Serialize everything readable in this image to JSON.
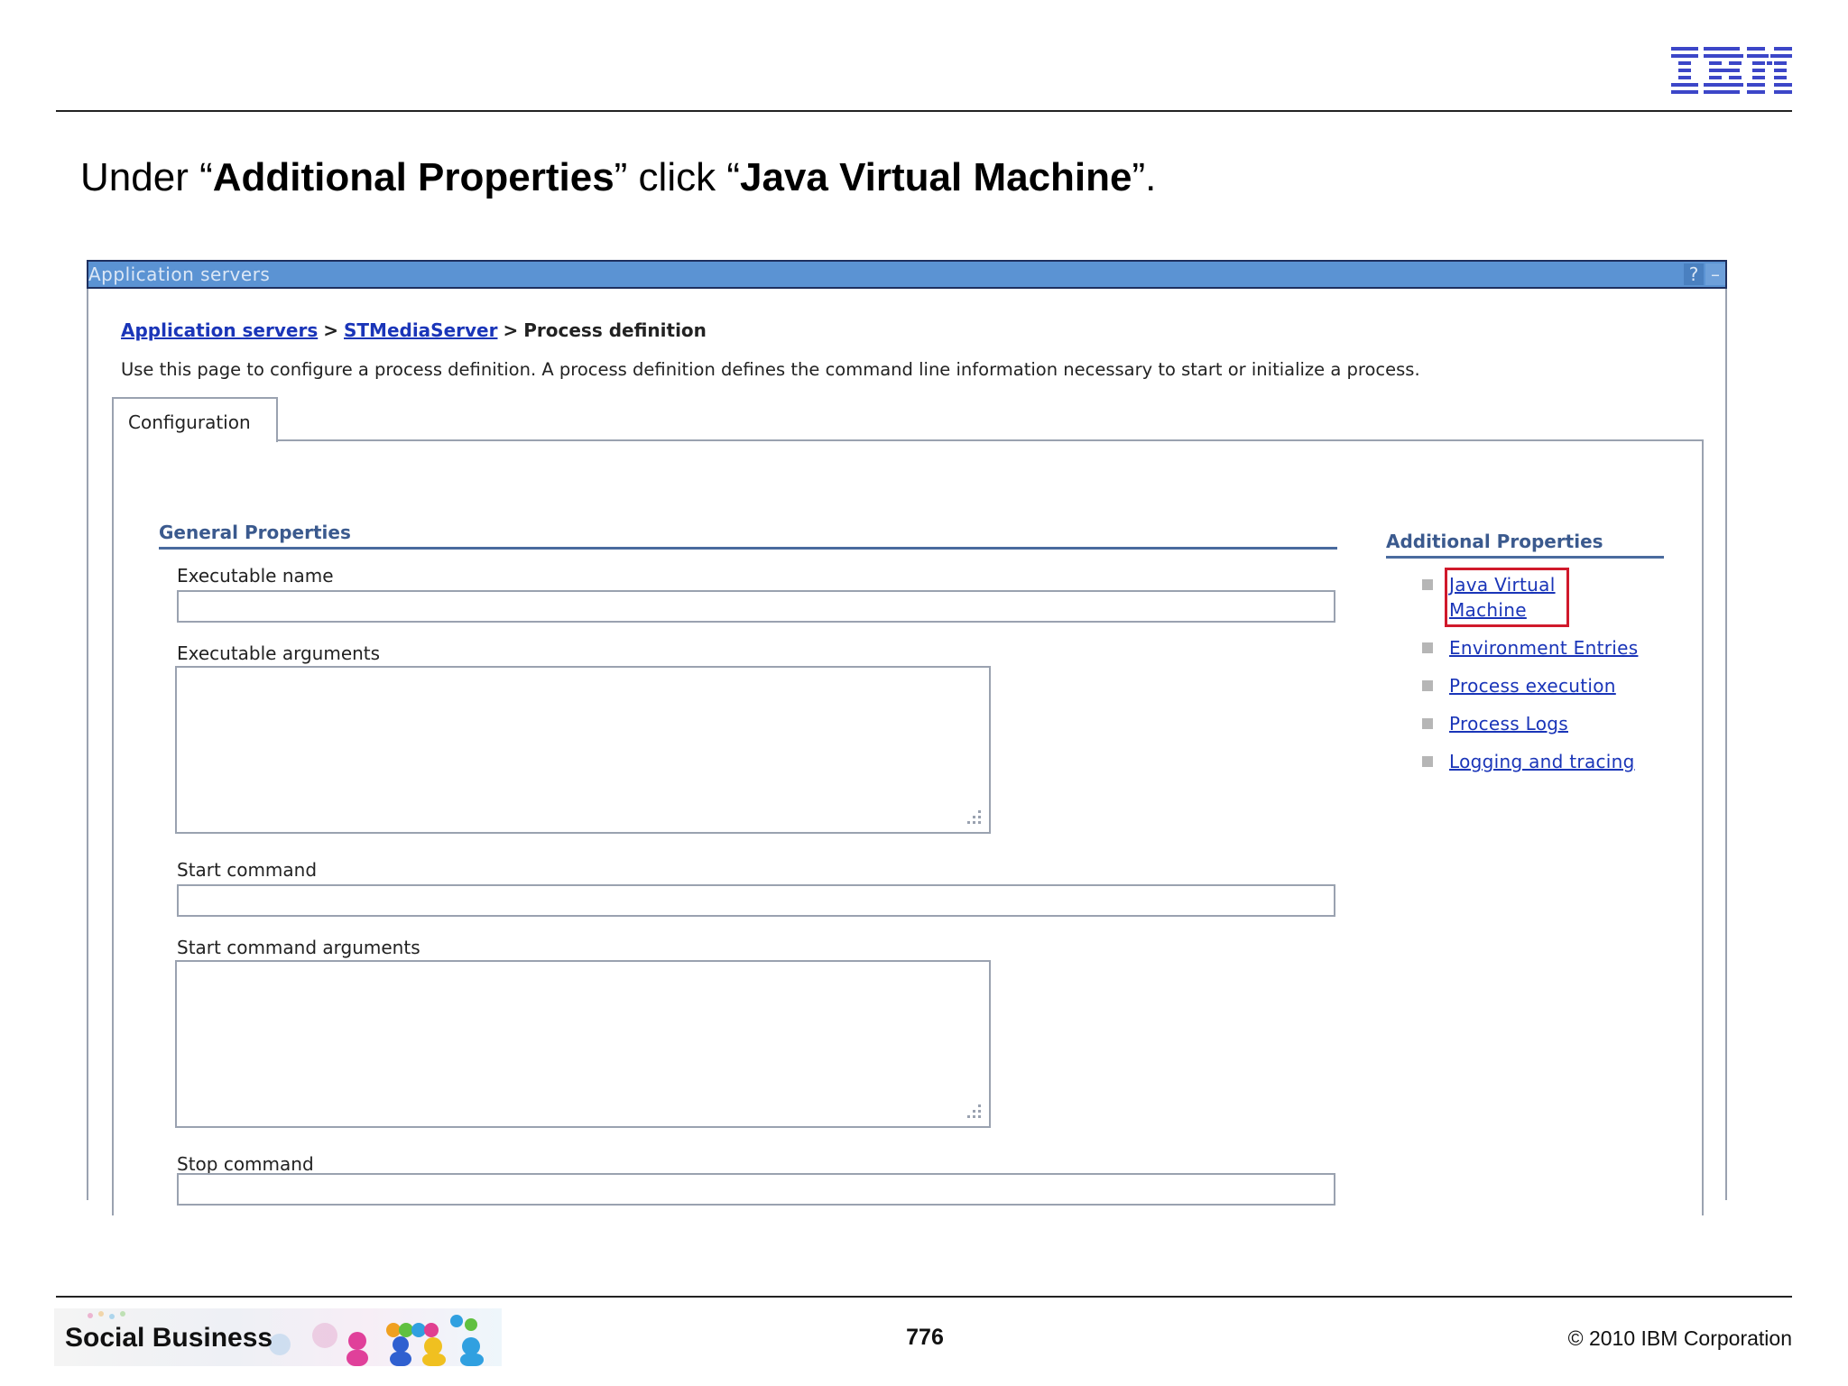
{
  "slide": {
    "logo_text": "IBM",
    "title": {
      "prefix": "Under “",
      "bold1": "Additional Properties",
      "mid": "” click “",
      "bold2": "Java Virtual Machine",
      "suffix": "”."
    },
    "footer": {
      "brand": "Social Business",
      "page_number": "776",
      "copyright": "© 2010 IBM Corporation"
    }
  },
  "panel": {
    "title": "Application servers",
    "help_icon": "?",
    "minimize_icon": "–",
    "breadcrumb": {
      "link1": "Application servers",
      "sep": ">",
      "link2": "STMediaServer",
      "current": "Process definition"
    },
    "description": "Use this page to configure a process definition. A process definition defines the command line information necessary to start or initialize a process.",
    "tab_label": "Configuration",
    "general_properties": {
      "title": "General Properties",
      "fields": [
        {
          "label": "Executable name",
          "value": ""
        },
        {
          "label": "Executable arguments",
          "value": ""
        },
        {
          "label": "Start command",
          "value": ""
        },
        {
          "label": "Start command arguments",
          "value": ""
        },
        {
          "label": "Stop command",
          "value": ""
        }
      ]
    },
    "additional_properties": {
      "title": "Additional Properties",
      "links": [
        {
          "label": "Java Virtual Machine",
          "highlighted": true
        },
        {
          "label": "Environment Entries",
          "highlighted": false
        },
        {
          "label": "Process execution",
          "highlighted": false
        },
        {
          "label": "Process Logs",
          "highlighted": false
        },
        {
          "label": "Logging and tracing",
          "highlighted": false
        }
      ]
    },
    "colors": {
      "titlebar": "#5b93d3",
      "link": "#1a35b8",
      "section_title": "#3b5a8e",
      "highlight": "#d0192b"
    }
  }
}
